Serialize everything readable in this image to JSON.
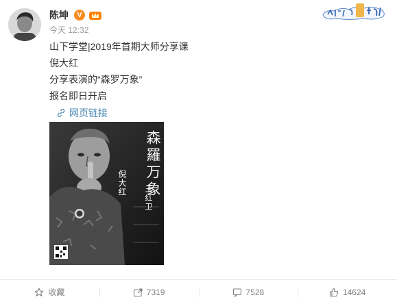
{
  "post": {
    "username": "陈坤",
    "verified_badge": "V",
    "time": "今天 12:32",
    "lines": [
      "山下学堂|2019年首期大师分享课",
      "倪大红",
      "分享表演的“森罗万象”",
      "报名即日开启"
    ],
    "link_label": "网页链接"
  },
  "poster": {
    "title_chars": "森羅万象",
    "main_name": "倪大红",
    "host_name": "王红卫"
  },
  "actions": {
    "favorite_label": "收藏",
    "repost_count": "7319",
    "comment_count": "7528",
    "like_count": "14624"
  },
  "colors": {
    "link": "#4b88b3",
    "verified": "#f78b21",
    "muted_text": "#808080"
  },
  "icons": [
    "avatar",
    "verified-badge",
    "crown-badge",
    "brand-badge",
    "link-icon",
    "star-icon",
    "repost-icon",
    "comment-icon",
    "like-icon"
  ]
}
